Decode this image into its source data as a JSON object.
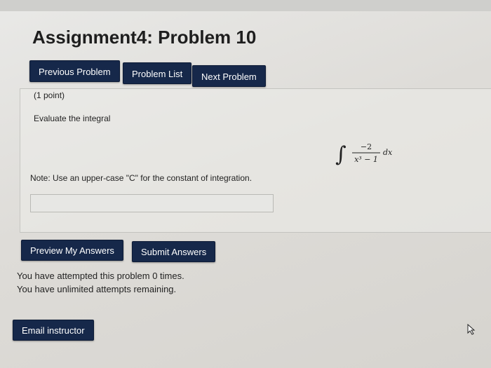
{
  "header": {
    "title": "Assignment4: Problem 10"
  },
  "nav": {
    "previous_label": "Previous Problem",
    "list_label": "Problem List",
    "next_label": "Next Problem"
  },
  "problem": {
    "points": "(1 point)",
    "instruction": "Evaluate the integral",
    "integral": {
      "numerator": "−2",
      "denominator": "x³ − 1",
      "differential": "dx"
    },
    "note": "Note: Use an upper-case \"C\" for the constant of integration.",
    "answer_value": ""
  },
  "actions": {
    "preview_label": "Preview My Answers",
    "submit_label": "Submit Answers"
  },
  "status": {
    "attempted": "You have attempted this problem 0 times.",
    "remaining": "You have unlimited attempts remaining."
  },
  "footer": {
    "email_label": "Email instructor"
  },
  "colors": {
    "button_bg": "#16284a",
    "button_text": "#ffffff"
  },
  "icons": {
    "cursor": "mouse-pointer-icon"
  }
}
